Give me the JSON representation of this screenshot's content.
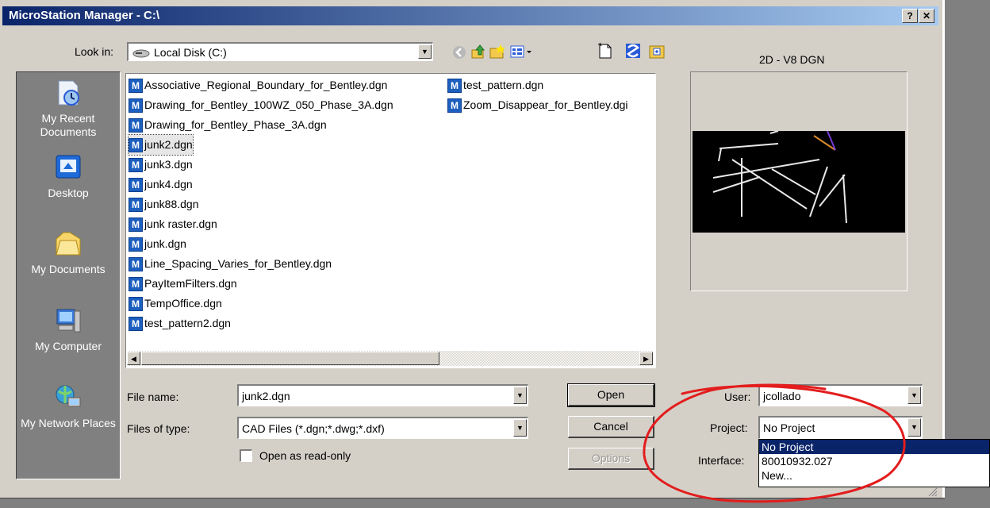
{
  "window": {
    "title": "MicroStation Manager - C:\\",
    "help_btn": "?",
    "close_btn": "✕"
  },
  "toolbar": {
    "look_in_label": "Look in:",
    "look_in_value": "Local Disk (C:)",
    "format_label": "2D - V8 DGN"
  },
  "places": [
    {
      "label": "My Recent Documents",
      "icon": "recent-documents-icon"
    },
    {
      "label": "Desktop",
      "icon": "desktop-icon"
    },
    {
      "label": "My Documents",
      "icon": "my-documents-icon"
    },
    {
      "label": "My Computer",
      "icon": "my-computer-icon"
    },
    {
      "label": "My Network Places",
      "icon": "network-places-icon"
    }
  ],
  "files_col1": [
    "Associative_Regional_Boundary_for_Bentley.dgn",
    "Drawing_for_Bentley_100WZ_050_Phase_3A.dgn",
    "Drawing_for_Bentley_Phase_3A.dgn",
    "junk2.dgn",
    "junk3.dgn",
    "junk4.dgn",
    "junk88.dgn",
    "junk raster.dgn",
    "junk.dgn",
    "Line_Spacing_Varies_for_Bentley.dgn",
    "PayItemFilters.dgn",
    "TempOffice.dgn",
    "test_pattern2.dgn"
  ],
  "files_col2": [
    "test_pattern.dgn",
    "Zoom_Disappear_for_Bentley.dgi"
  ],
  "selected_file": "junk2.dgn",
  "form": {
    "file_name_label": "File name:",
    "file_name_value": "junk2.dgn",
    "files_of_type_label": "Files of type:",
    "files_of_type_value": "CAD Files (*.dgn;*.dwg;*.dxf)",
    "read_only_label": "Open as read-only",
    "read_only_checked": false
  },
  "buttons": {
    "open": "Open",
    "cancel": "Cancel",
    "options": "Options"
  },
  "settings": {
    "user_label": "User:",
    "user_value": "jcollado",
    "project_label": "Project:",
    "project_value": "No Project",
    "interface_label": "Interface:"
  },
  "project_options": [
    "No Project",
    "80010932.027",
    "New..."
  ],
  "project_selected_index": 0,
  "annotation_color": "#e31d1d"
}
